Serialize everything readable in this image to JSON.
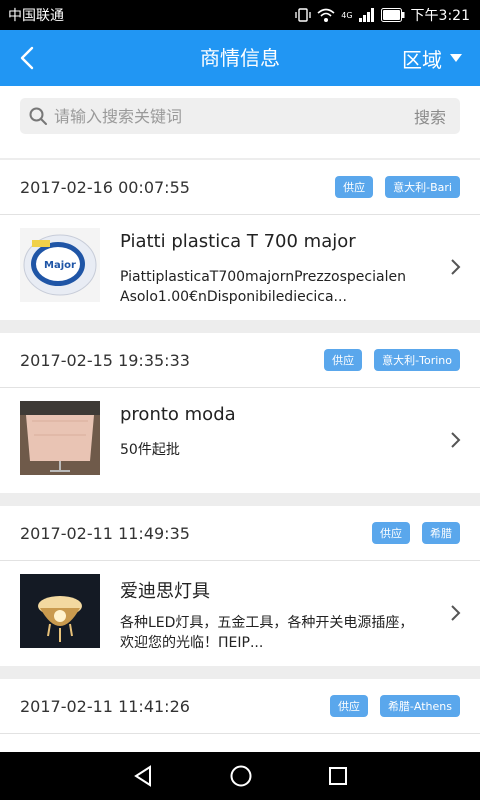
{
  "status": {
    "carrier": "中国联通",
    "network": "4G",
    "time": "下午3:21"
  },
  "nav": {
    "title": "商情信息",
    "region": "区域"
  },
  "search": {
    "placeholder": "请输入搜索关键词",
    "button": "搜索"
  },
  "listings": [
    {
      "date": "2017-02-16 00:07:55",
      "tags": [
        "供应",
        "意大利-Bari"
      ],
      "title": "Piatti plastica T 700 major",
      "desc": "PiattiplasticaT700majornPrezzospecialenAsolo1.00€nDisponibilediecica...",
      "thumb": "plates"
    },
    {
      "date": "2017-02-15 19:35:33",
      "tags": [
        "供应",
        "意大利-Torino"
      ],
      "title": "pronto moda",
      "desc": "50件起批",
      "thumb": "clothes"
    },
    {
      "date": "2017-02-11 11:49:35",
      "tags": [
        "供应",
        "希腊"
      ],
      "title": "爱迪思灯具",
      "desc": "各种LED灯具，五金工具，各种开关电源插座，欢迎您的光临！ΠΕΙΡ...",
      "thumb": "chandelier"
    },
    {
      "date": "2017-02-11 11:41:26",
      "tags": [
        "供应",
        "希腊-Athens"
      ],
      "title": "",
      "desc": "",
      "thumb": ""
    }
  ]
}
